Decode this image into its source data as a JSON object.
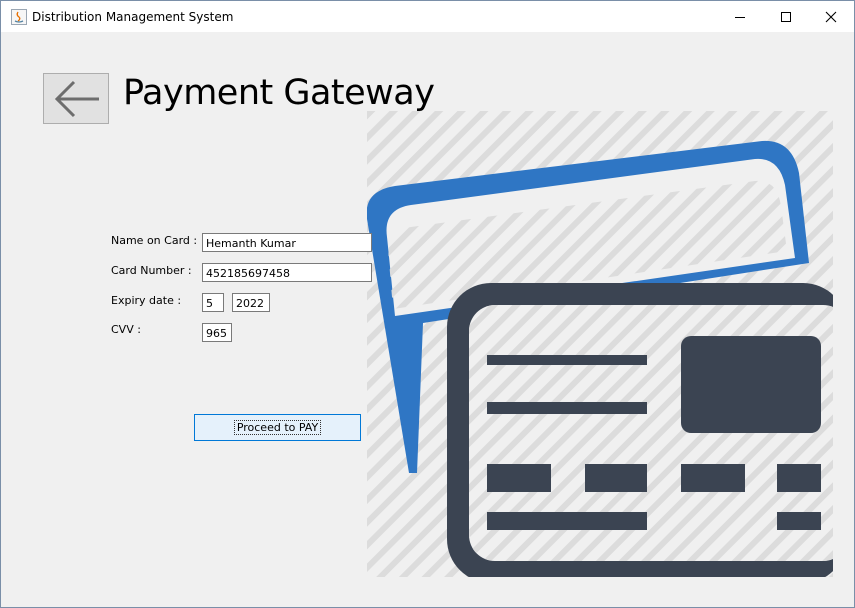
{
  "window": {
    "title": "Distribution Management System"
  },
  "header": {
    "title": "Payment Gateway"
  },
  "form": {
    "name_label": "Name on Card :",
    "name_value": "Hemanth Kumar",
    "card_label": "Card Number :",
    "card_value": "452185697458",
    "expiry_label": "Expiry date :",
    "expiry_month": "5",
    "expiry_year": "2022",
    "cvv_label": "CVV :",
    "cvv_value": "965",
    "pay_label": "Proceed to PAY"
  },
  "colors": {
    "card_back": "#2f76c4",
    "card_front": "#3b4452",
    "stripes": "#dcdcdc"
  }
}
